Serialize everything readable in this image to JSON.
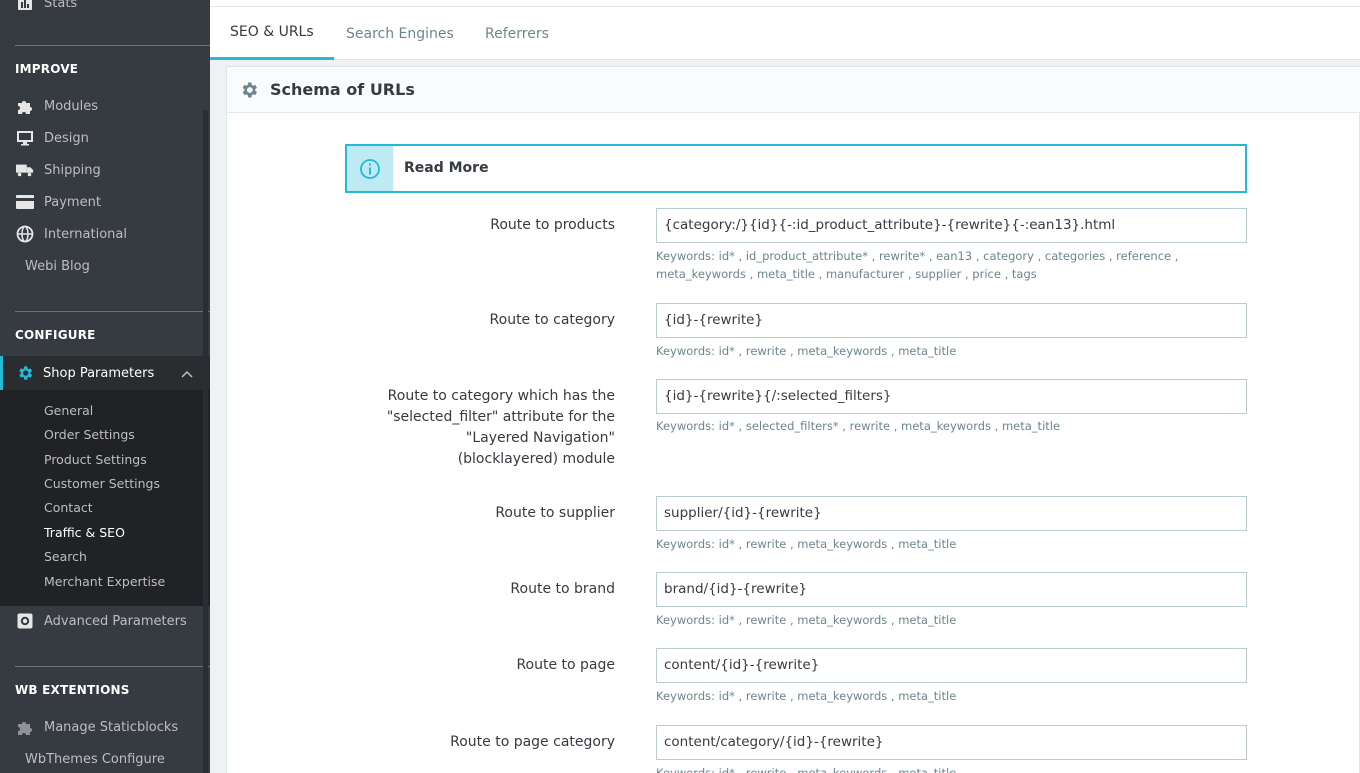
{
  "sidebar": {
    "stats_label": "Stats",
    "improve_heading": "IMPROVE",
    "improve_items": [
      {
        "label": "Modules",
        "icon": "puzzle-icon"
      },
      {
        "label": "Design",
        "icon": "monitor-icon"
      },
      {
        "label": "Shipping",
        "icon": "truck-icon"
      },
      {
        "label": "Payment",
        "icon": "credit-card-icon"
      },
      {
        "label": "International",
        "icon": "globe-icon"
      }
    ],
    "webi_blog": "Webi Blog",
    "configure_heading": "CONFIGURE",
    "shop_parameters": "Shop Parameters",
    "sub_items": [
      "General",
      "Order Settings",
      "Product Settings",
      "Customer Settings",
      "Contact",
      "Traffic & SEO",
      "Search",
      "Merchant Expertise"
    ],
    "advanced_parameters": "Advanced Parameters",
    "wb_heading": "WB EXTENTIONS",
    "manage_staticblocks": "Manage Staticblocks",
    "wbthemes_configure": "WbThemes Configure"
  },
  "tabs": [
    "SEO & URLs",
    "Search Engines",
    "Referrers"
  ],
  "panel": {
    "title": "Schema of URLs",
    "alert": "Read More"
  },
  "routes": [
    {
      "label": "Route to products",
      "value": "{category:/}{id}{-:id_product_attribute}-{rewrite}{-:ean13}.html",
      "help": "Keywords: id* , id_product_attribute* , rewrite* , ean13 , category , categories , reference , meta_keywords , meta_title , manufacturer , supplier , price , tags"
    },
    {
      "label": "Route to category",
      "value": "{id}-{rewrite}",
      "help": "Keywords: id* , rewrite , meta_keywords , meta_title"
    },
    {
      "label": "Route to category which has the \"selected_filter\" attribute for the \"Layered Navigation\" (blocklayered) module",
      "value": "{id}-{rewrite}{/:selected_filters}",
      "help": "Keywords: id* , selected_filters* , rewrite , meta_keywords , meta_title"
    },
    {
      "label": "Route to supplier",
      "value": "supplier/{id}-{rewrite}",
      "help": "Keywords: id* , rewrite , meta_keywords , meta_title"
    },
    {
      "label": "Route to brand",
      "value": "brand/{id}-{rewrite}",
      "help": "Keywords: id* , rewrite , meta_keywords , meta_title"
    },
    {
      "label": "Route to page",
      "value": "content/{id}-{rewrite}",
      "help": "Keywords: id* , rewrite , meta_keywords , meta_title"
    },
    {
      "label": "Route to page category",
      "value": "content/category/{id}-{rewrite}",
      "help": "Keywords: id* , rewrite , meta_keywords , meta_title"
    }
  ],
  "colors": {
    "sidebar_bg": "#363a41",
    "accent": "#25b9d7",
    "help_text": "#6c868e"
  }
}
